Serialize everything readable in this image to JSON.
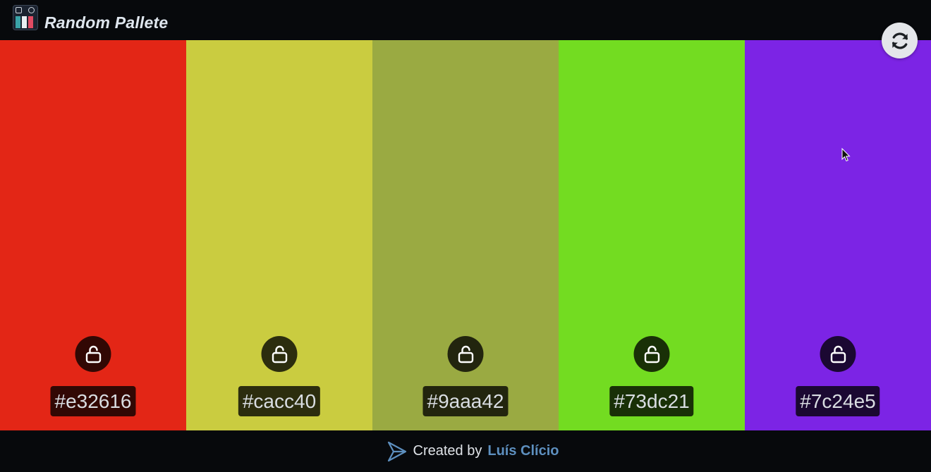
{
  "header": {
    "title": "Random Pallete"
  },
  "palette": [
    {
      "color": "#e32616",
      "label": "#e32616",
      "icon": "unlocked-padlock-icon"
    },
    {
      "color": "#cacc40",
      "label": "#cacc40",
      "icon": "unlocked-padlock-icon"
    },
    {
      "color": "#9aaa42",
      "label": "#9aaa42",
      "icon": "unlocked-padlock-icon"
    },
    {
      "color": "#73dc21",
      "label": "#73dc21",
      "icon": "unlocked-padlock-icon"
    },
    {
      "color": "#7c24e5",
      "label": "#7c24e5",
      "icon": "unlocked-padlock-icon"
    }
  ],
  "refresh": {
    "icon": "refresh-icon"
  },
  "footer": {
    "prefix": "Created by",
    "author": "Luís Clício",
    "author_color": "#5d8fbf"
  }
}
